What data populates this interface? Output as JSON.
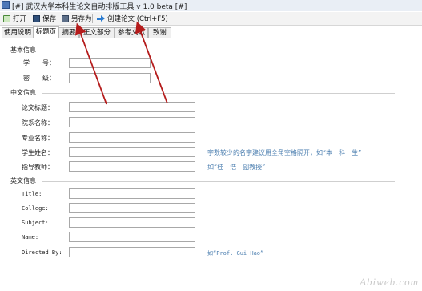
{
  "window": {
    "title": "[#] 武汉大学本科生论文自动排版工具 v 1.0 beta [#]"
  },
  "toolbar": {
    "open_label": "打开",
    "save_label": "保存",
    "saveas_label": "另存为",
    "create_label": "创建论文 (Ctrl+F5)"
  },
  "tabs": [
    "使用说明",
    "标题页",
    "摘要",
    "正文部分",
    "参考文献",
    "致谢"
  ],
  "active_tab": "标题页",
  "basic": {
    "title": "基本信息",
    "student_id_label": "学　　号：",
    "student_id_value": "",
    "grade_label": "密　　级：",
    "grade_value": ""
  },
  "chinese": {
    "title": "中文信息",
    "thesis_title_label": "论文标题：",
    "thesis_title_value": "",
    "department_label": "院系名称：",
    "department_value": "",
    "major_label": "专业名称：",
    "major_value": "",
    "student_name_label": "学生姓名：",
    "student_name_value": "",
    "student_name_hint": "字数较少的名字建议用全角空格隔开，如“本　科　生”",
    "advisor_label": "指导教师：",
    "advisor_value": "",
    "advisor_hint": "如“桂　浩　副教授”"
  },
  "english": {
    "title": "英文信息",
    "title_label": "Title:",
    "title_value": "",
    "college_label": "College:",
    "college_value": "",
    "subject_label": "Subject:",
    "subject_value": "",
    "name_label": "Name:",
    "name_value": "",
    "directed_label": "Directed By:",
    "directed_value": "",
    "directed_hint": "如“Prof. Gui Hao”"
  },
  "watermark": "Abiweb.com",
  "colors": {
    "annotation_arrow": "#b51c1c",
    "hint_text": "#4c7fb0"
  }
}
